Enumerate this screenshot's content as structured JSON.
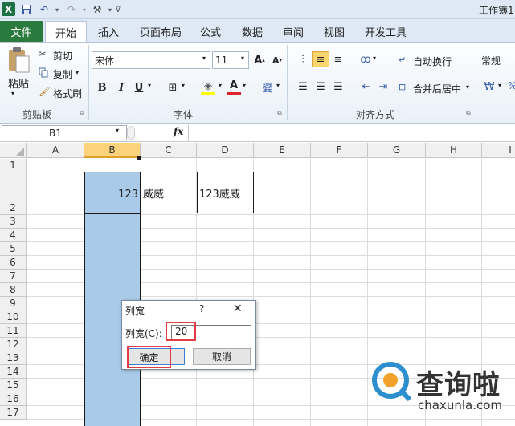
{
  "title_bar": {
    "title": "工作簿1"
  },
  "tabs": [
    "文件",
    "开始",
    "插入",
    "页面布局",
    "公式",
    "数据",
    "审阅",
    "视图",
    "开发工具"
  ],
  "clipboard": {
    "paste": "粘贴",
    "cut": "剪切",
    "copy": "复制",
    "format_painter": "格式刷",
    "group": "剪贴板"
  },
  "font": {
    "name": "宋体",
    "size": "11",
    "bold": "B",
    "italic": "I",
    "underline": "U",
    "group": "字体"
  },
  "alignment": {
    "wrap": "自动换行",
    "merge": "合并后居中",
    "group": "对齐方式"
  },
  "number": {
    "format": "常规"
  },
  "formula_bar": {
    "name_box": "B1",
    "fx": "fx",
    "value": ""
  },
  "columns": [
    "A",
    "B",
    "C",
    "D",
    "E",
    "F",
    "G",
    "H",
    "I"
  ],
  "rows": [
    "1",
    "2",
    "3",
    "4",
    "5",
    "6",
    "7",
    "8",
    "9",
    "10",
    "11",
    "12",
    "13",
    "14",
    "15",
    "16",
    "17"
  ],
  "cells": {
    "B2": "123",
    "C2": "威威",
    "D2": "123威威"
  },
  "dialog": {
    "title": "列宽",
    "help": "?",
    "close": "✕",
    "label": "列宽(C):",
    "value": "20",
    "ok": "确定",
    "cancel": "取消"
  },
  "watermark": {
    "brand": "查询啦",
    "url": "chaxunla.com"
  },
  "colors": {
    "accent": "#2a7a3e",
    "selection": "#a9cbe9",
    "highlight": "#e23d46"
  }
}
